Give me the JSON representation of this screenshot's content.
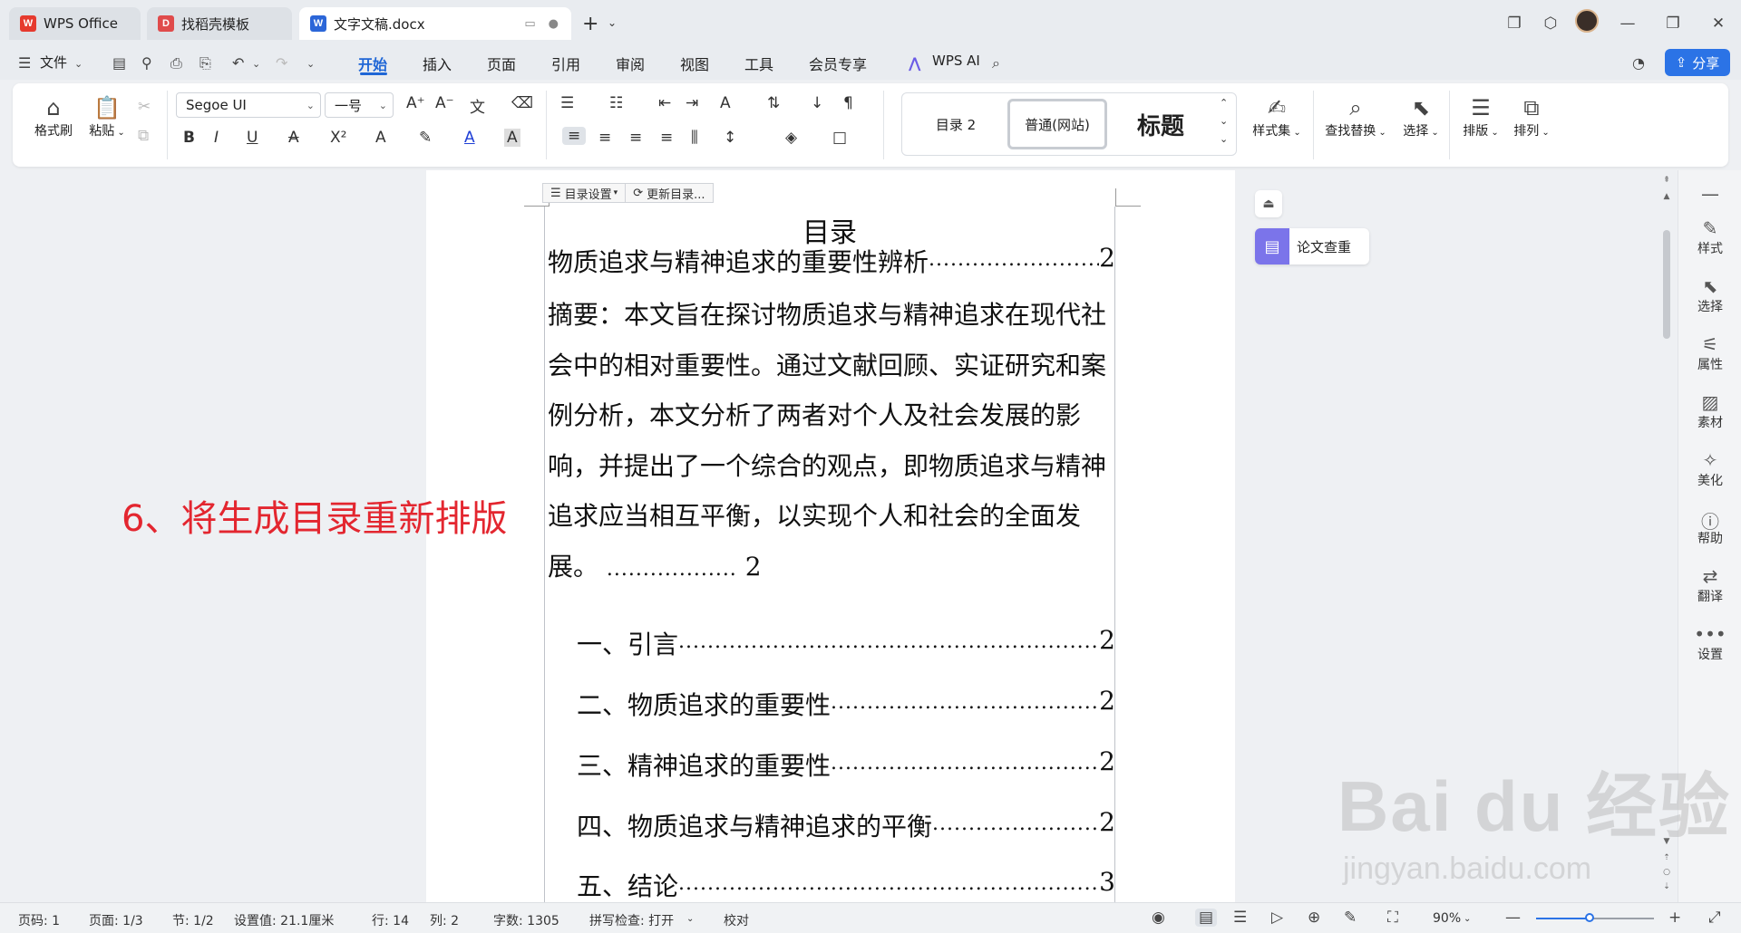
{
  "titlebar": {
    "tabs": [
      {
        "label": "WPS Office",
        "logo": "W",
        "logo_color": "#e63a2e"
      },
      {
        "label": "找稻壳模板",
        "logo": "D",
        "logo_color": "#e04b4b"
      },
      {
        "label": "文字文稿.docx",
        "logo": "W",
        "logo_color": "#2b66d8"
      }
    ]
  },
  "menubar": {
    "file_label": "文件",
    "tabs": [
      "开始",
      "插入",
      "页面",
      "引用",
      "审阅",
      "视图",
      "工具",
      "会员专享"
    ],
    "active_tab": "开始",
    "wps_ai_label": "WPS AI",
    "share_label": "分享"
  },
  "ribbon": {
    "format_painter": "格式刷",
    "paste": "粘贴",
    "font_name": "Segoe UI",
    "font_size": "一号",
    "styles": {
      "toc2": "目录 2",
      "normal_web": "普通(网站)",
      "heading": "标题"
    },
    "style_set": "样式集",
    "find_replace": "查找替换",
    "select": "选择",
    "layout": "排版",
    "arrange": "排列"
  },
  "document": {
    "toc_settings": "目录设置",
    "update_toc": "更新目录...",
    "title": "目录",
    "entries": [
      {
        "text": "物质追求与精神追求的重要性辨析",
        "page": "2"
      },
      {
        "text": "一、引言",
        "page": "2"
      },
      {
        "text": "二、物质追求的重要性",
        "page": "2"
      },
      {
        "text": "三、精神追求的重要性",
        "page": "2"
      },
      {
        "text": "四、物质追求与精神追求的平衡",
        "page": "2"
      },
      {
        "text": "五、结论",
        "page": "3"
      }
    ],
    "abstract": "摘要：本文旨在探讨物质追求与精神追求在现代社会中的相对重要性。通过文献回顾、实证研究和案例分析，本文分析了两者对个人及社会发展的影响，并提出了一个综合的观点，即物质追求与精神追求应当相互平衡，以实现个人和社会的全面发展。",
    "abstract_page": "2",
    "dot_leader": "................................................................................................................................"
  },
  "annotation": "6、将生成目录重新排版",
  "side_panel": {
    "paper_check": "论文查重"
  },
  "rightbar": [
    "样式",
    "选择",
    "属性",
    "素材",
    "美化",
    "帮助",
    "翻译",
    "设置"
  ],
  "statusbar": {
    "page_code": "页码: 1",
    "pages": "页面: 1/3",
    "section": "节: 1/2",
    "position": "设置值: 21.1厘米",
    "row": "行: 14",
    "col": "列: 2",
    "word_count": "字数: 1305",
    "spell_check": "拼写检查: 打开",
    "proofread": "校对",
    "zoom": "90%",
    "zoom_level": 0.45
  },
  "watermark": {
    "brand": "Bai du 经验",
    "url": "jingyan.baidu.com"
  }
}
